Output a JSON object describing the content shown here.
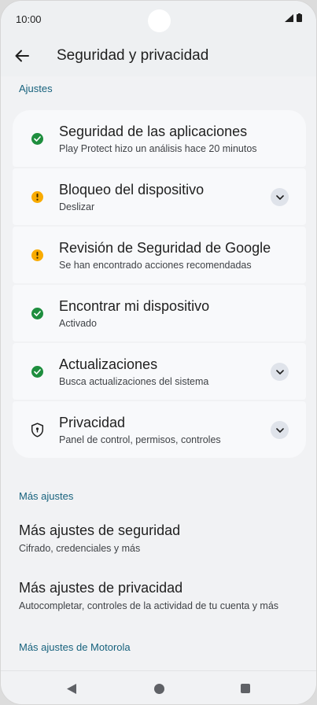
{
  "status_bar": {
    "time": "10:00"
  },
  "header": {
    "title": "Seguridad y privacidad"
  },
  "sections": {
    "settings": "Ajustes",
    "more": "Más ajustes",
    "motorola": "Más ajustes de Motorola"
  },
  "items": [
    {
      "title": "Seguridad de las aplicaciones",
      "subtitle": "Play Protect hizo un análisis hace 20 minutos",
      "status": "ok",
      "expandable": false
    },
    {
      "title": "Bloqueo del dispositivo",
      "subtitle": "Deslizar",
      "status": "warning",
      "expandable": true
    },
    {
      "title": "Revisión de Seguridad de Google",
      "subtitle": "Se han encontrado acciones recomendadas",
      "status": "warning",
      "expandable": false
    },
    {
      "title": "Encontrar mi dispositivo",
      "subtitle": "Activado",
      "status": "ok",
      "expandable": false
    },
    {
      "title": "Actualizaciones",
      "subtitle": "Busca actualizaciones del sistema",
      "status": "ok",
      "expandable": true
    },
    {
      "title": "Privacidad",
      "subtitle": "Panel de control, permisos, controles",
      "status": "shield",
      "expandable": true
    }
  ],
  "more_items": [
    {
      "title": "Más ajustes de seguridad",
      "subtitle": "Cifrado, credenciales y más"
    },
    {
      "title": "Más ajustes de privacidad",
      "subtitle": "Autocompletar, controles de la actividad de tu cuenta y más"
    }
  ],
  "colors": {
    "ok": "#1e8e3e",
    "warning": "#f9ab00",
    "accent": "#17627d"
  },
  "icons": {
    "back": "arrow-back-icon",
    "ok": "check-circle-icon",
    "warning": "exclamation-circle-icon",
    "shield": "shield-icon",
    "expand": "chevron-down-icon"
  }
}
